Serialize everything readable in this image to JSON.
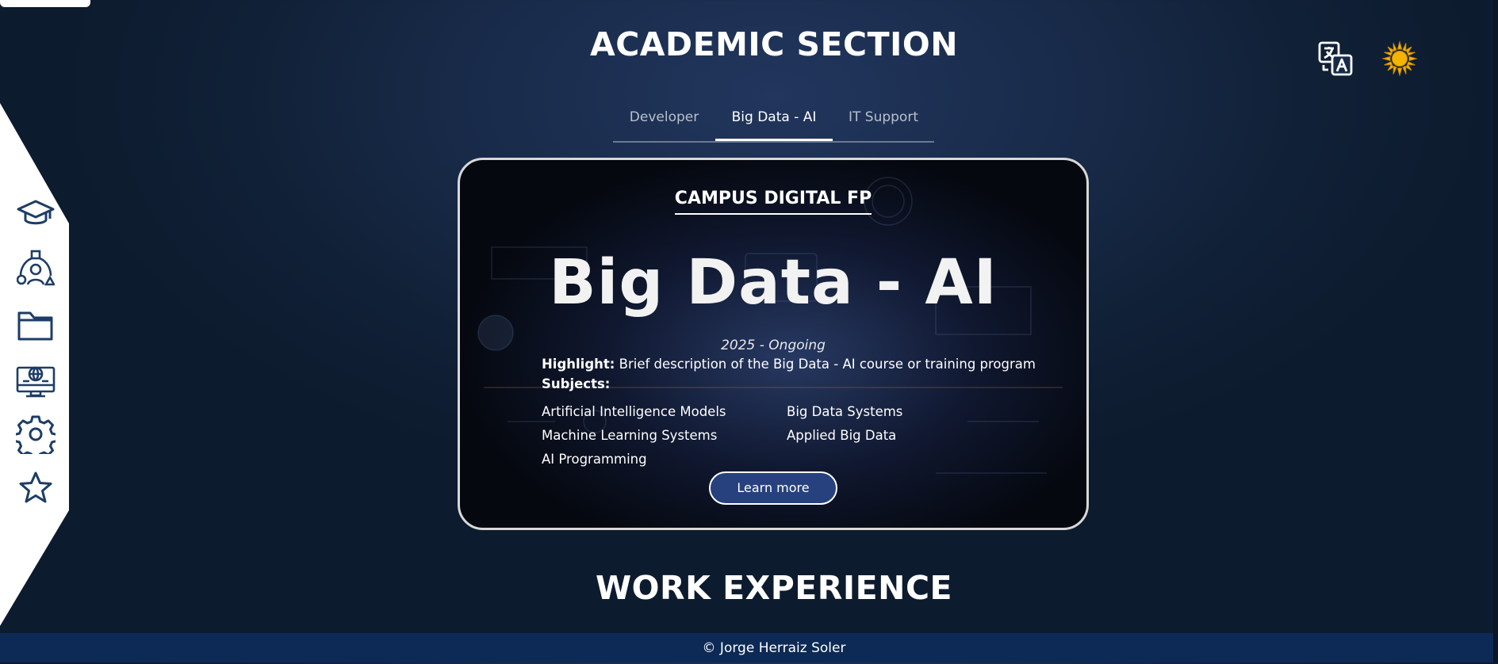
{
  "header": {
    "academic_title": "ACADEMIC SECTION",
    "work_title": "WORK EXPERIENCE"
  },
  "toolbar_icons": [
    "translate-icon",
    "sun-icon"
  ],
  "sidebar": {
    "items": [
      {
        "icon": "graduation-cap-icon"
      },
      {
        "icon": "network-people-icon"
      },
      {
        "icon": "folder-icon"
      },
      {
        "icon": "computer-globe-icon"
      },
      {
        "icon": "gear-icon"
      },
      {
        "icon": "star-icon"
      }
    ]
  },
  "tabs": [
    {
      "label": "Developer",
      "active": false
    },
    {
      "label": "Big Data - AI",
      "active": true
    },
    {
      "label": "IT Support",
      "active": false
    }
  ],
  "card": {
    "institution": "CAMPUS DIGITAL FP",
    "title": "Big Data - AI",
    "date": "2025 - Ongoing",
    "highlight_label": "Highlight:",
    "highlight_text": " Brief description of the Big Data - AI course or training program",
    "subjects_label": "Subjects:",
    "subjects": [
      "Artificial Intelligence Models",
      "Big Data Systems",
      "Machine Learning Systems",
      "Applied Big Data",
      "AI Programming"
    ],
    "button_label": "Learn more"
  },
  "footer": {
    "text": "© Jorge Herraiz Soler"
  },
  "colors": {
    "background": "#142640",
    "footer": "#0c2a55",
    "button": "#26417e",
    "sidebar_icon": "#1d3d66",
    "sun": "#f5b400"
  }
}
